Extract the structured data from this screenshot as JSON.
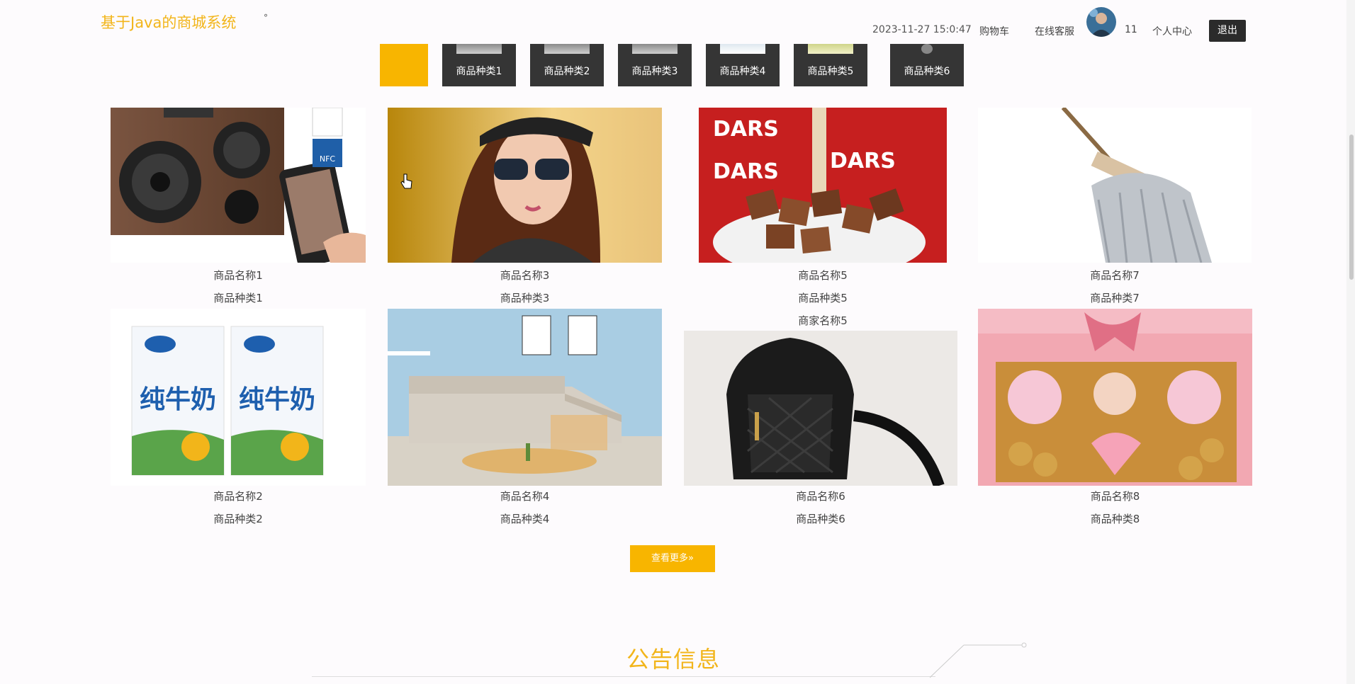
{
  "header": {
    "site_title": "基于Java的商城系统",
    "dot": "°",
    "datetime": "2023-11-27 15:0:47",
    "cart": "购物车",
    "service": "在线客服",
    "user_id": "11",
    "profile": "个人中心",
    "logout": "退出"
  },
  "categories": [
    "商品种类1",
    "商品种类2",
    "商品种类3",
    "商品种类4",
    "商品种类5",
    "商品种类6"
  ],
  "products": [
    {
      "name": "商品名称1",
      "category": "商品种类1",
      "icon": "speaker-image"
    },
    {
      "name": "商品名称3",
      "category": "商品种类3",
      "icon": "sunglasses-woman-image"
    },
    {
      "name": "商品名称5",
      "category": "商品种类5",
      "merchant": "商家名称5",
      "icon": "chocolate-image"
    },
    {
      "name": "商品名称7",
      "category": "商品种类7",
      "icon": "mop-image"
    },
    {
      "name": "商品名称2",
      "category": "商品种类2",
      "icon": "milk-carton-image"
    },
    {
      "name": "商品名称4",
      "category": "商品种类4",
      "icon": "sofa-image"
    },
    {
      "name": "商品名称6",
      "category": "商品种类6",
      "icon": "backpack-image"
    },
    {
      "name": "商品名称8",
      "category": "商品种类8",
      "icon": "candy-box-image"
    }
  ],
  "more_button": "查看更多»",
  "notice_title": "公告信息",
  "colors": {
    "accent": "#f8b500",
    "title": "#f2b51a",
    "dark": "#353535"
  }
}
